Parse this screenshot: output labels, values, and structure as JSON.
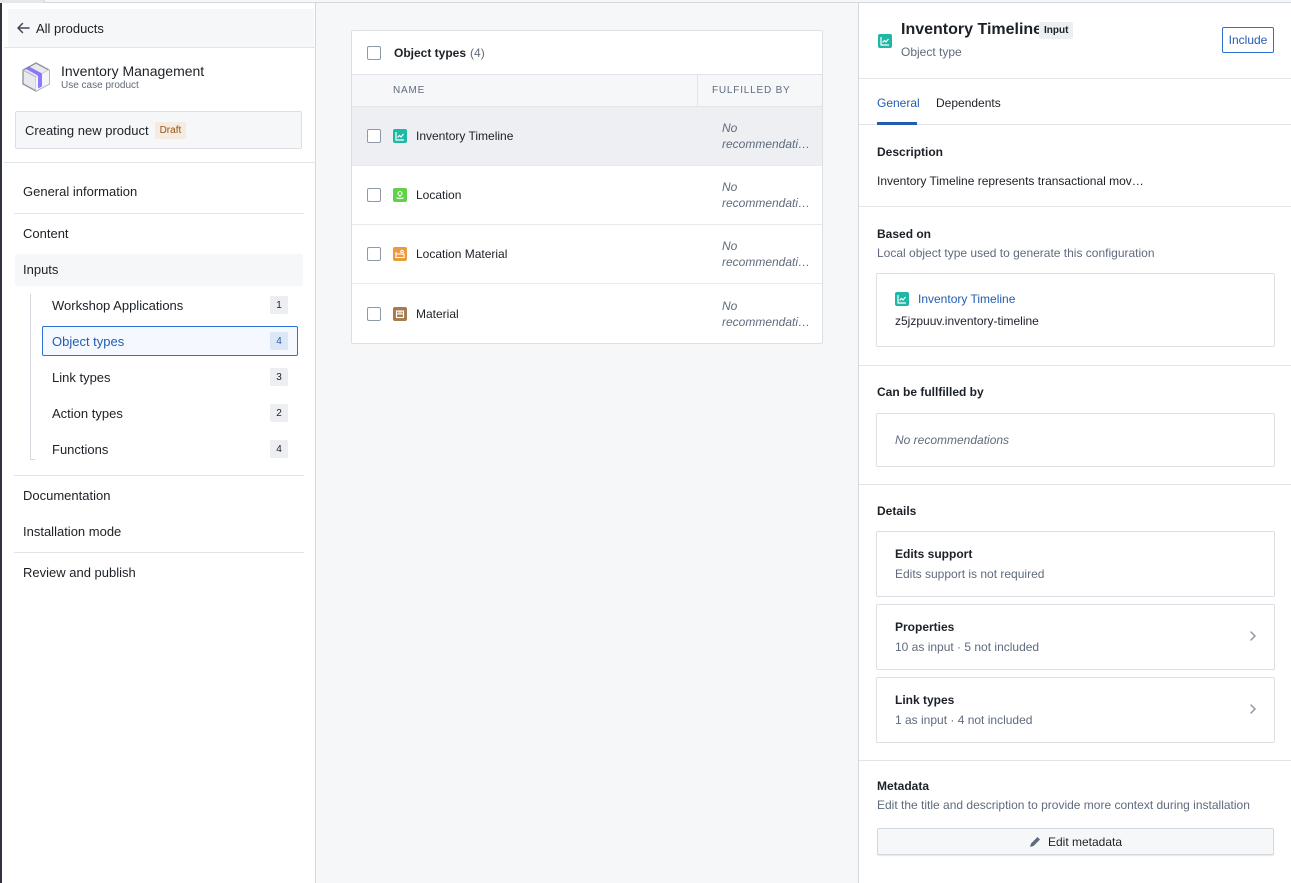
{
  "sidebar": {
    "back_label": "All products",
    "product": {
      "name": "Inventory Management",
      "type": "Use case product",
      "icon": "cube-icon"
    },
    "status": {
      "text": "Creating new product",
      "tag": "Draft"
    },
    "nav": {
      "general_information": "General information",
      "content": "Content",
      "inputs": "Inputs",
      "documentation": "Documentation",
      "installation_mode": "Installation mode",
      "review_and_publish": "Review and publish"
    },
    "input_items": [
      {
        "label": "Workshop Applications",
        "count": "1",
        "active": false
      },
      {
        "label": "Object types",
        "count": "4",
        "active": true
      },
      {
        "label": "Link types",
        "count": "3",
        "active": false
      },
      {
        "label": "Action types",
        "count": "2",
        "active": false
      },
      {
        "label": "Functions",
        "count": "4",
        "active": false
      }
    ]
  },
  "table": {
    "title": "Object types",
    "count": "(4)",
    "columns": {
      "name": "NAME",
      "fulfilled_by": "FULFILLED BY"
    },
    "rows": [
      {
        "name": "Inventory Timeline",
        "icon": "timeline-chart-icon",
        "color": "#1fb7a5",
        "fulfilled_line1": "No",
        "fulfilled_line2": "recommendations",
        "selected": true
      },
      {
        "name": "Location",
        "icon": "location-icon",
        "color": "#62d14a",
        "fulfilled_line1": "No",
        "fulfilled_line2": "recommendations",
        "selected": false
      },
      {
        "name": "Location Material",
        "icon": "location-material-icon",
        "color": "#ec9a3c",
        "fulfilled_line1": "No",
        "fulfilled_line2": "recommendations",
        "selected": false
      },
      {
        "name": "Material",
        "icon": "material-box-icon",
        "color": "#a67a4e",
        "fulfilled_line1": "No",
        "fulfilled_line2": "recommendations",
        "selected": false
      }
    ]
  },
  "detail": {
    "title": "Inventory Timeline",
    "tag": "Input",
    "subtitle": "Object type",
    "include_label": "Include",
    "tabs": [
      {
        "label": "General",
        "active": true
      },
      {
        "label": "Dependents",
        "active": false
      }
    ],
    "description": {
      "title": "Description",
      "text": "Inventory Timeline represents transactional mov…"
    },
    "based_on": {
      "title": "Based on",
      "subtitle": "Local object type used to generate this configuration",
      "link": "Inventory Timeline",
      "api_name": "z5jzpuuv.inventory-timeline"
    },
    "fulfilled": {
      "title": "Can be fullfilled by",
      "empty": "No recommendations"
    },
    "details": {
      "title": "Details",
      "edits": {
        "title": "Edits support",
        "text": "Edits support is not required"
      },
      "properties": {
        "title": "Properties",
        "text": "10 as input · 5 not included"
      },
      "link_types": {
        "title": "Link types",
        "text": "1 as input · 4 not included"
      }
    },
    "metadata": {
      "title": "Metadata",
      "subtitle": "Edit the title and description to provide more context during installation",
      "button": "Edit metadata"
    }
  },
  "colors": {
    "accent": "#215db0",
    "teal": "#1fb7a5",
    "draft": "#935610"
  }
}
